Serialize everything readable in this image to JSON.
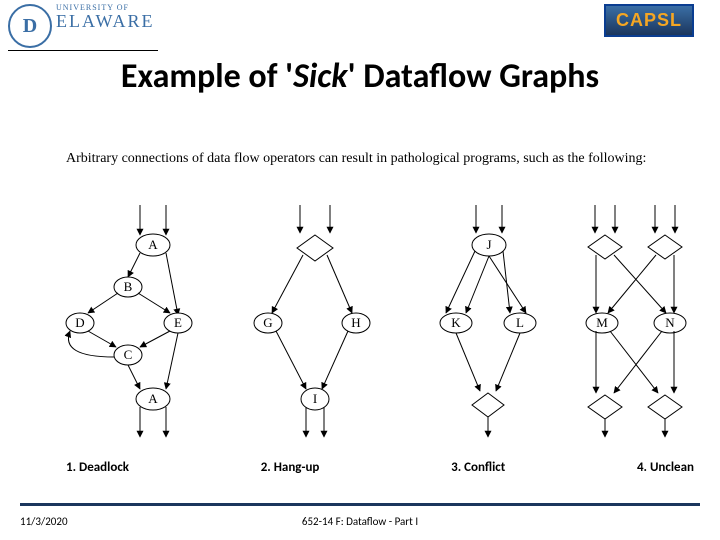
{
  "brand": {
    "univ_small": "UNIVERSITY OF",
    "univ_big": "ELAWARE",
    "capsl": "CAPSL"
  },
  "title": {
    "pre": "Example of '",
    "sick": "Sick",
    "post": "' Dataflow Graphs"
  },
  "intro": "Arbitrary connections of data flow operators can result in pathological programs, such as the following:",
  "nodes": {
    "A": "A",
    "B": "B",
    "C": "C",
    "D": "D",
    "E": "E",
    "G": "G",
    "H": "H",
    "I": "I",
    "J": "J",
    "K": "K",
    "L": "L",
    "M": "M",
    "N": "N",
    "A2": "A"
  },
  "captions": {
    "c1": "1. Deadlock",
    "c2": "2. Hang-up",
    "c3": "3. Conflict",
    "c4": "4. Unclean"
  },
  "footer": {
    "date": "11/3/2020",
    "center": "652-14 F: Dataflow - Part I"
  }
}
